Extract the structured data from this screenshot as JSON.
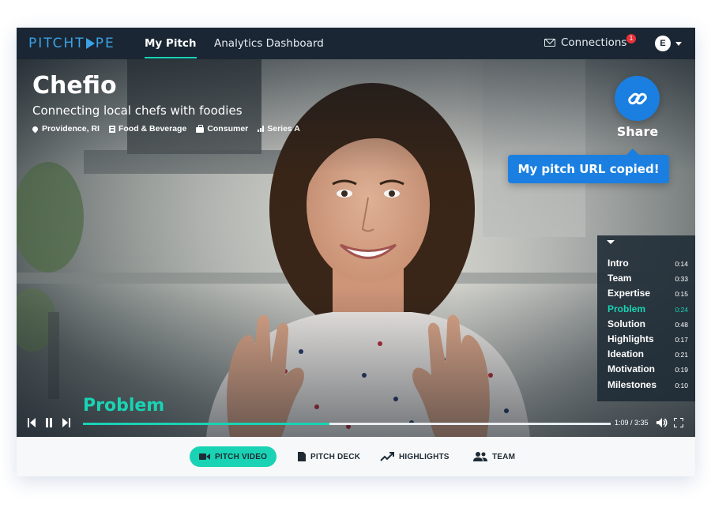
{
  "brand": {
    "logo_left": "PITCHT",
    "logo_right": "PE"
  },
  "nav": {
    "tabs": [
      {
        "label": "My Pitch",
        "active": true
      },
      {
        "label": "Analytics Dashboard",
        "active": false
      }
    ],
    "connections_label": "Connections",
    "connections_badge": "1",
    "avatar_initial": "E"
  },
  "pitch": {
    "company": "Chefio",
    "tagline": "Connecting local chefs with foodies",
    "location": "Providence,  RI",
    "industry": "Food & Beverage",
    "market": "Consumer",
    "stage": "Series A"
  },
  "share": {
    "label": "Share",
    "toast": "My pitch URL copied!"
  },
  "chapters": [
    {
      "label": "Intro",
      "time": "0:14",
      "active": false
    },
    {
      "label": "Team",
      "time": "0:33",
      "active": false
    },
    {
      "label": "Expertise",
      "time": "0:15",
      "active": false
    },
    {
      "label": "Problem",
      "time": "0:24",
      "active": true
    },
    {
      "label": "Solution",
      "time": "0:48",
      "active": false
    },
    {
      "label": "Highlights",
      "time": "0:17",
      "active": false
    },
    {
      "label": "Ideation",
      "time": "0:21",
      "active": false
    },
    {
      "label": "Motivation",
      "time": "0:19",
      "active": false
    },
    {
      "label": "Milestones",
      "time": "0:10",
      "active": false
    }
  ],
  "player": {
    "current_chapter": "Problem",
    "time_display": "1:09 / 3:35",
    "progress_fraction": 0.467
  },
  "bottom_tabs": [
    {
      "label": "PITCH VIDEO",
      "icon": "video-camera-icon",
      "active": true
    },
    {
      "label": "PITCH DECK",
      "icon": "document-icon",
      "active": false
    },
    {
      "label": "HIGHLIGHTS",
      "icon": "trend-up-icon",
      "active": false
    },
    {
      "label": "TEAM",
      "icon": "people-icon",
      "active": false
    }
  ],
  "colors": {
    "accent": "#19d3b4",
    "share_blue": "#1a7fe0",
    "nav_bg": "#1a2633",
    "logo_blue": "#3aa3e8",
    "badge_red": "#e8323a"
  }
}
